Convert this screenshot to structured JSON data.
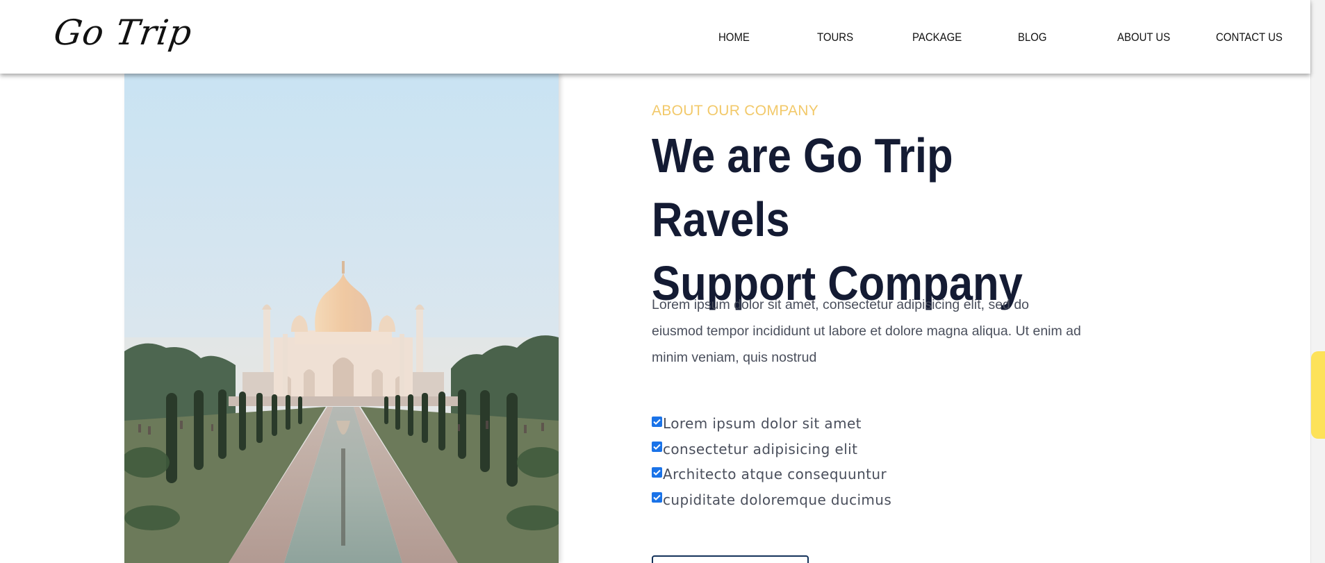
{
  "header": {
    "logo": "Go Trip",
    "nav": [
      "HOME",
      "TOURS",
      "PACKAGE",
      "BLOG",
      "ABOUT US",
      "CONTACT US"
    ]
  },
  "hero_image": {
    "subject": "Taj Mahal with reflecting pool"
  },
  "about": {
    "eyebrow": "ABOUT OUR COMPANY",
    "headline_line1": "We are Go Trip Ravels",
    "headline_line2": "Support Company",
    "body": "Lorem ipsum dolor sit amet, consectetur adipisicing elit, sed do eiusmod tempor incididunt ut labore et dolore magna aliqua. Ut enim ad minim veniam, quis nostrud",
    "checklist": [
      "Lorem ipsum dolor sit amet",
      "consectetur adipisicing elit",
      "Architecto atque consequuntur",
      "cupiditate doloremque ducimus"
    ]
  },
  "colors": {
    "accent_gold": "#f2c96a",
    "headline_navy": "#141b33",
    "scroll_thumb": "#fde25a",
    "checkbox_blue": "#1a73e8"
  },
  "icons": [
    "checkbox-checked-icon"
  ]
}
